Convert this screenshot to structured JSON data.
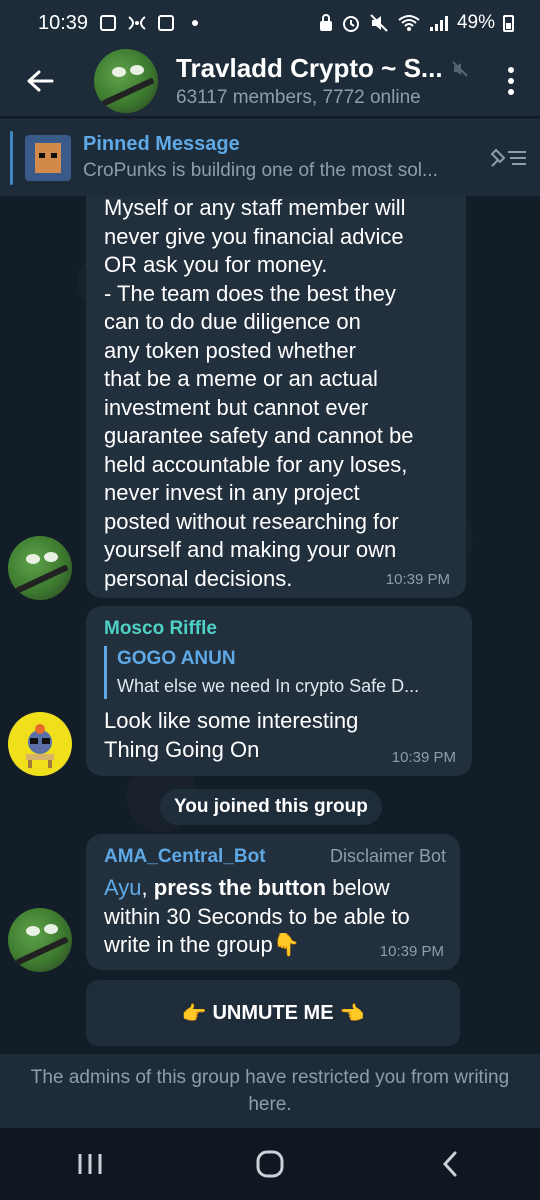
{
  "status_bar": {
    "time": "10:39",
    "battery": "49%",
    "icons": [
      "gallery-icon",
      "nfc-icon",
      "shop-icon",
      "lock-icon",
      "alarm-icon",
      "mute-icon",
      "wifi-icon",
      "signal-icon"
    ]
  },
  "header": {
    "title": "Travladd Crypto ~ S...",
    "subtitle": "63117 members, 7772 online"
  },
  "pinned": {
    "label": "Pinned Message",
    "preview": "CroPunks is building one of the most sol..."
  },
  "messages": [
    {
      "text": "Myself or any staff member will\nnever give you financial advice\nOR ask you for money.\n- The team does the best they\ncan to do due diligence on\nany token posted whether\nthat be a meme or an actual\ninvestment but cannot ever\nguarantee safety and cannot be\nheld accountable for any loses,\nnever invest in any project\nposted without researching for\nyourself and making your own\npersonal decisions.",
      "time": "10:39 PM"
    },
    {
      "sender": "Mosco Riffle",
      "reply_name": "GOGO ANUN",
      "reply_text": "What else we need In crypto Safe D...",
      "text": "Look like some interesting\nThing Going On",
      "time": "10:39 PM"
    },
    {
      "sender": "AMA_Central_Bot",
      "tag": "Disclaimer Bot",
      "mention": "Ayu",
      "bold_part": "press the button",
      "text_after": " below\nwithin 30 Seconds to be able to\nwrite in the group",
      "emoji": "👇",
      "time": "10:39 PM"
    }
  ],
  "service_message": "You joined this group",
  "inline_button": {
    "label": "UNMUTE ME",
    "left_emoji": "👉",
    "right_emoji": "👈"
  },
  "restricted_text": "The admins of this group have restricted you from writing here.",
  "colors": {
    "accent": "#5ea9e6",
    "mosco_name": "#4fd1c5",
    "bot_name": "#5ea9e6",
    "bubble": "#222f3d",
    "header": "#1e2c3a"
  }
}
